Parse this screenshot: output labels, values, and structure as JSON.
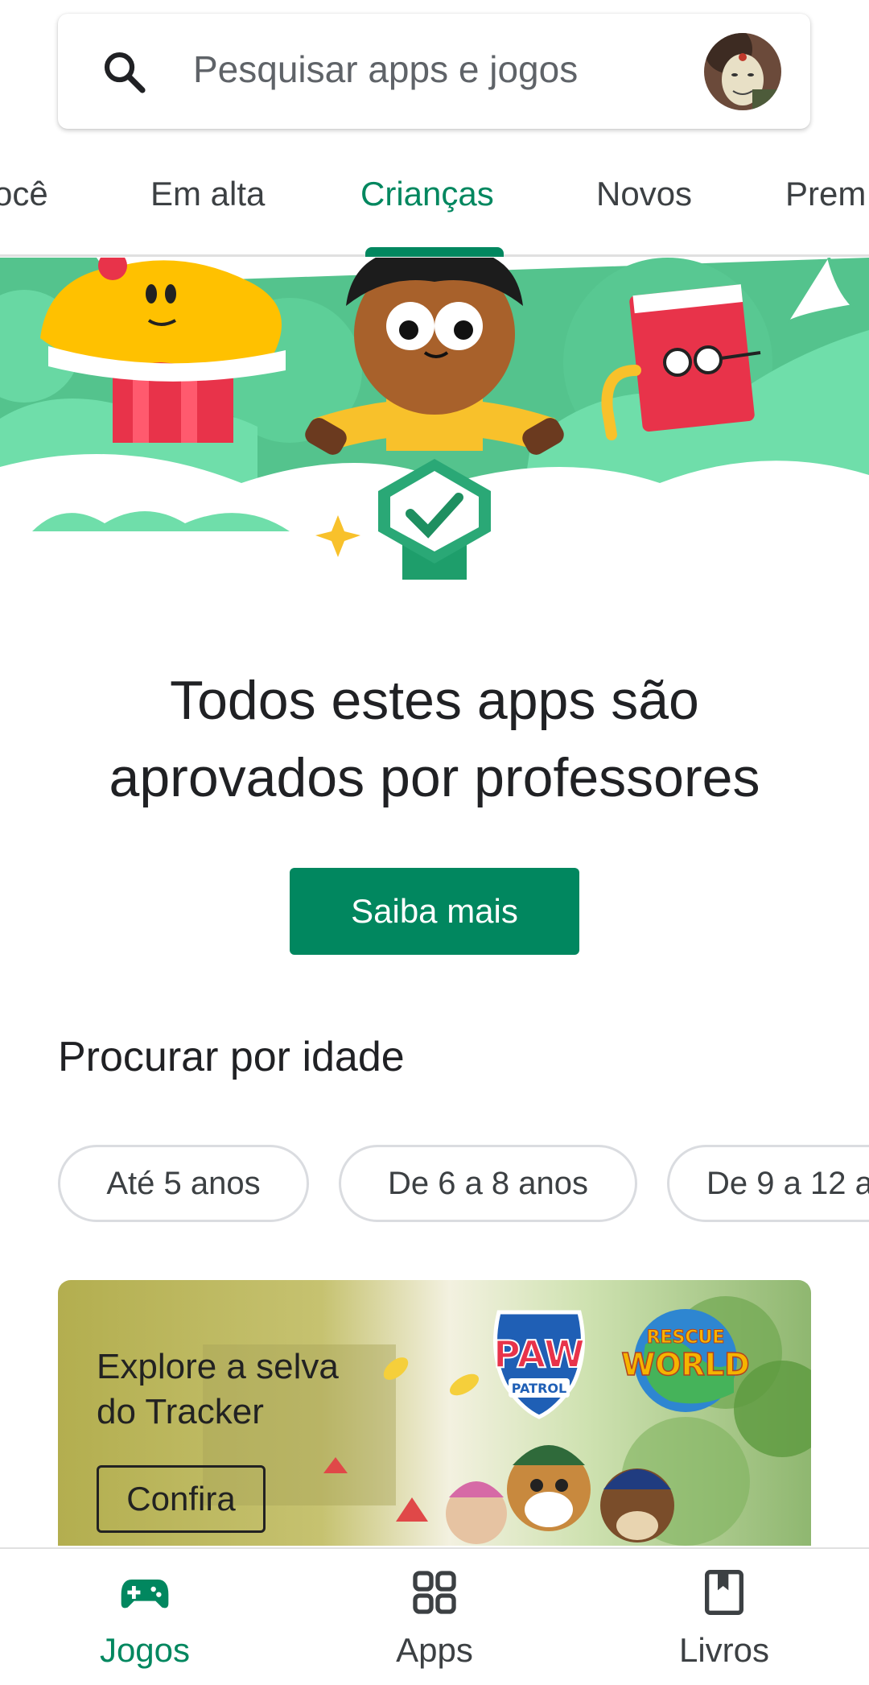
{
  "search": {
    "placeholder": "Pesquisar apps e jogos"
  },
  "tabs": [
    {
      "label": "ocê"
    },
    {
      "label": "Em alta"
    },
    {
      "label": "Crianças"
    },
    {
      "label": "Novos"
    },
    {
      "label": "Prem"
    }
  ],
  "active_tab_index": 2,
  "hero": {
    "title_line1": "Todos estes apps são",
    "title_line2": "aprovados por professores",
    "cta_label": "Saiba mais"
  },
  "age_section": {
    "title": "Procurar por idade",
    "chips": [
      {
        "label": "Até 5 anos"
      },
      {
        "label": "De 6 a 8 anos"
      },
      {
        "label": "De 9 a 12 a"
      }
    ]
  },
  "promo": {
    "title": "Explore a selva do Tracker",
    "button_label": "Confira",
    "logo_text_1": "PAW",
    "logo_text_2": "PATROL",
    "logo_text_3": "RESCUE",
    "logo_text_4": "WORLD"
  },
  "bottom_nav": [
    {
      "label": "Jogos",
      "icon": "gamepad-icon",
      "active": true
    },
    {
      "label": "Apps",
      "icon": "apps-grid-icon",
      "active": false
    },
    {
      "label": "Livros",
      "icon": "book-icon",
      "active": false
    }
  ],
  "colors": {
    "accent": "#01875f",
    "text": "#202124",
    "hero_green": "#5fd39e"
  }
}
